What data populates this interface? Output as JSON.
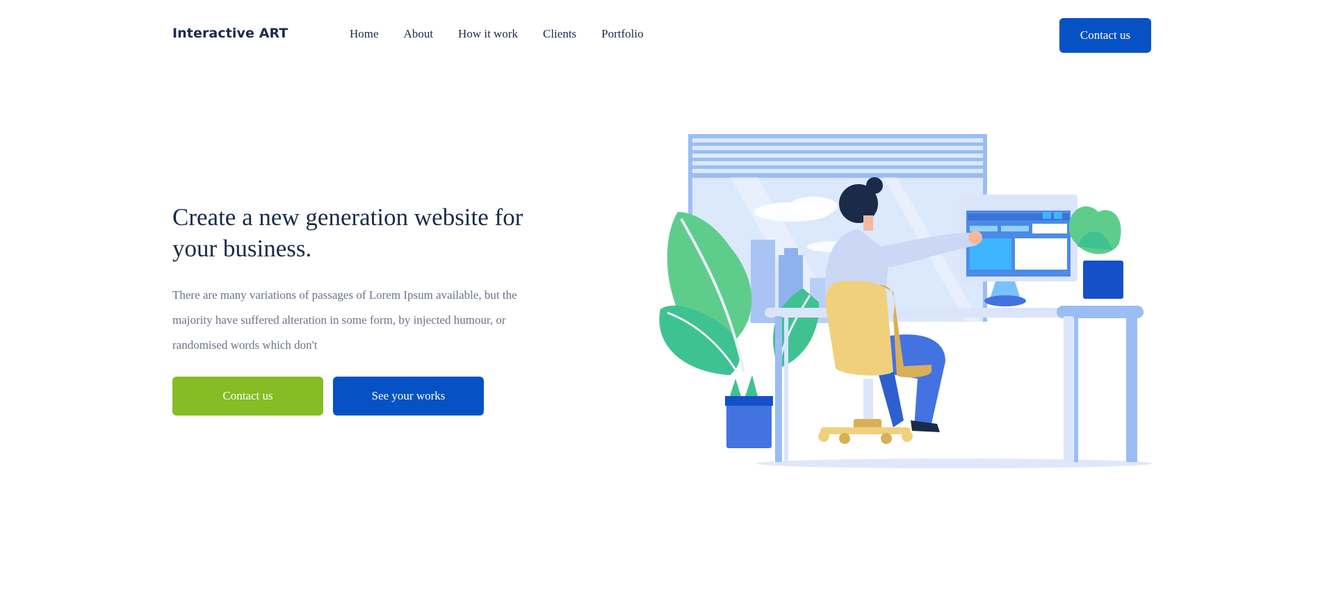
{
  "nav": {
    "logo": "Interactive ART",
    "links": [
      "Home",
      "About",
      "How it work",
      "Clients",
      "Portfolio"
    ],
    "contact_label": "Contact us"
  },
  "hero": {
    "title": "Create a new generation website for your business.",
    "description": "There are many variations of passages of Lorem Ipsum available, but the majority have suffered alteration in some form, by injected humour, or randomised words which don't",
    "primary_button": "Contact us",
    "secondary_button": "See your works"
  },
  "colors": {
    "brand_blue": "#0652c5",
    "accent_green": "#86bc24",
    "heading": "#1b2a49",
    "body_text": "#6b7388"
  }
}
